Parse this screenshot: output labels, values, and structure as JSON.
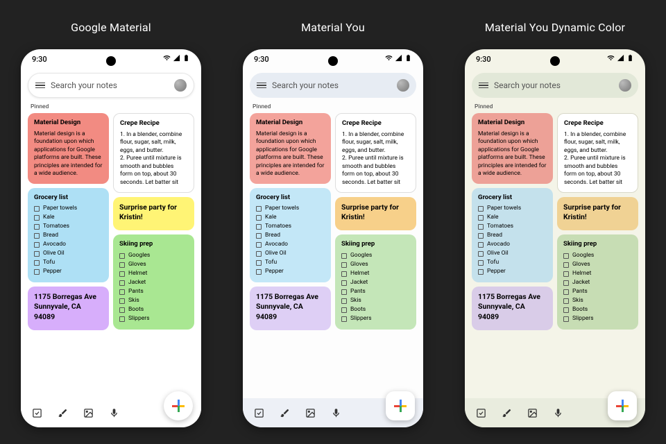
{
  "variants": [
    {
      "title": "Google Material"
    },
    {
      "title": "Material You"
    },
    {
      "title": "Material You Dynamic Color"
    }
  ],
  "status": {
    "time": "9:30"
  },
  "search": {
    "placeholder": "Search your notes"
  },
  "pinned_label": "Pinned",
  "notes": {
    "md": {
      "title": "Material Design",
      "body": "Material design is a foundation upon which applications for Google platforms are built. These principles are intended for a wide audience."
    },
    "crepe": {
      "title": "Crepe Recipe",
      "body": "1. In a blender, combine flour, sugar, salt, milk, eggs, and butter.\n2. Puree until mixture is smooth and bubbles form on top, about 30 seconds. Let batter sit"
    },
    "grocery": {
      "title": "Grocery list",
      "items": [
        "Paper towels",
        "Kale",
        "Tomatoes",
        "Bread",
        "Avocado",
        "Olive Oil",
        "Tofu",
        "Pepper"
      ]
    },
    "surprise": {
      "title": "Surprise party for Kristin!"
    },
    "skiing": {
      "title": "Skiing prep",
      "items": [
        "Googles",
        "Gloves",
        "Helmet",
        "Jacket",
        "Pants",
        "Skis",
        "Boots",
        "Slippers"
      ]
    },
    "address": {
      "title": "1175 Borregas Ave Sunnyvale, CA 94089"
    }
  },
  "colors": {
    "v1": {
      "md": "#f28b82",
      "grocery": "#aee0f5",
      "surprise": "#fff475",
      "skiing": "#a9e792",
      "address": "#d7aefb"
    },
    "v2": {
      "md": "#f3a39b",
      "grocery": "#c3e7f7",
      "surprise": "#f7d08a",
      "skiing": "#c4e6b8",
      "address": "#decff5"
    },
    "v3": {
      "md": "#eda197",
      "grocery": "#c4e1ec",
      "surprise": "#f0d294",
      "skiing": "#c7ddb4",
      "address": "#d9cce8"
    }
  }
}
